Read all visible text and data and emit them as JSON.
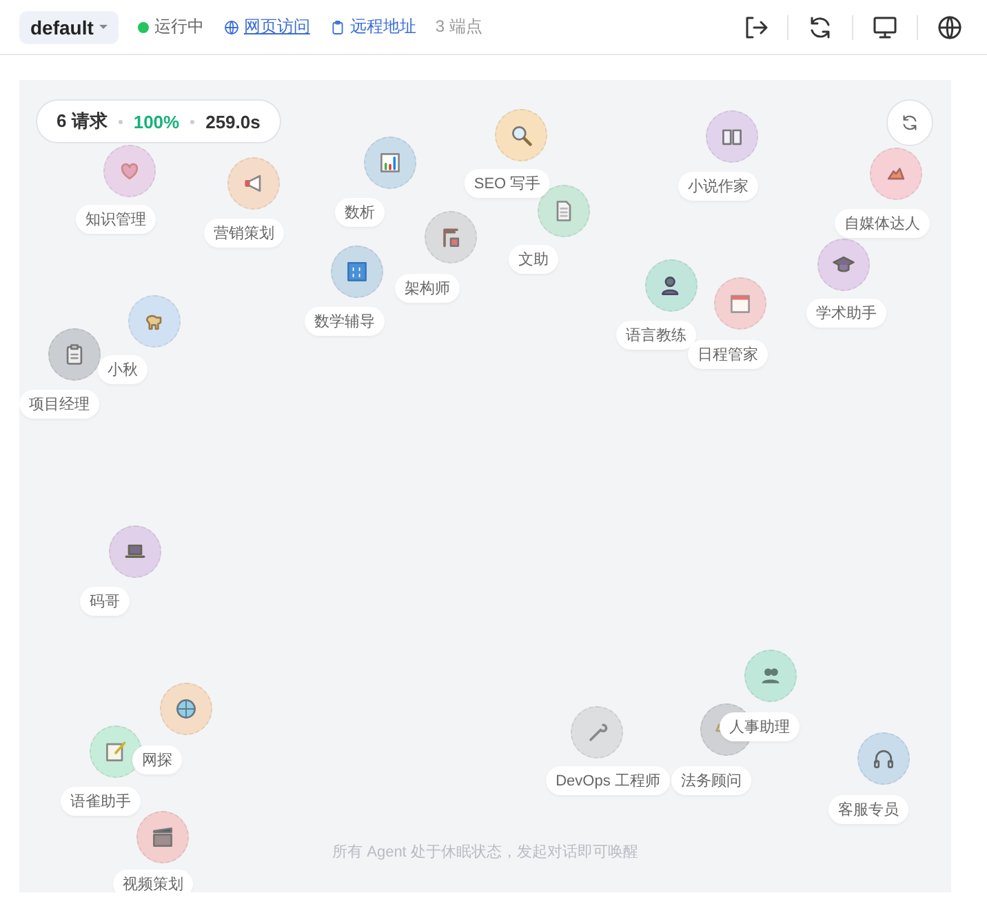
{
  "header": {
    "workspace": "default",
    "status": {
      "label": "运行中",
      "running": true
    },
    "links": [
      {
        "label": "网页访问"
      },
      {
        "label": "远程地址"
      }
    ],
    "endpoints": "3 端点"
  },
  "stats": {
    "requests": "6 请求",
    "success": "100%",
    "duration": "259.0s"
  },
  "nodes": [
    {
      "name": "知识管理",
      "color": "#e9d3e9"
    },
    {
      "name": "营销策划",
      "color": "#f5dcc8"
    },
    {
      "name": "数析",
      "color": "#c9dcea"
    },
    {
      "name": "SEO 写手",
      "color": "#f7e0bb"
    },
    {
      "name": "文助",
      "color": "#c9e8d7"
    },
    {
      "name": "架构师",
      "color": "#d9dbdd"
    },
    {
      "name": "数学辅导",
      "color": "#c6dae8"
    },
    {
      "name": "小说作家",
      "color": "#e2d3ec"
    },
    {
      "name": "自媒体达人",
      "color": "#f6d0d5"
    },
    {
      "name": "学术助手",
      "color": "#e3d0ea"
    },
    {
      "name": "语言教练",
      "color": "#c0e6dc"
    },
    {
      "name": "日程管家",
      "color": "#f4d0d0"
    },
    {
      "name": "小秋",
      "color": "#d0e1f4"
    },
    {
      "name": "项目经理",
      "color": "#cacdd1"
    },
    {
      "name": "码哥",
      "color": "#e1d0e9"
    },
    {
      "name": "网探",
      "color": "#f5dcc4"
    },
    {
      "name": "语雀助手",
      "color": "#c6ecda"
    },
    {
      "name": "视频策划",
      "color": "#f4cdcd"
    },
    {
      "name": "DevOps 工程师",
      "color": "#dcdee0"
    },
    {
      "name": "人事助理",
      "color": "#c0e8da"
    },
    {
      "name": "法务顾问",
      "color": "#cfd1d4"
    },
    {
      "name": "客服专员",
      "color": "#c9dcec"
    }
  ],
  "footer": "所有 Agent 处于休眠状态，发起对话即可唤醒"
}
